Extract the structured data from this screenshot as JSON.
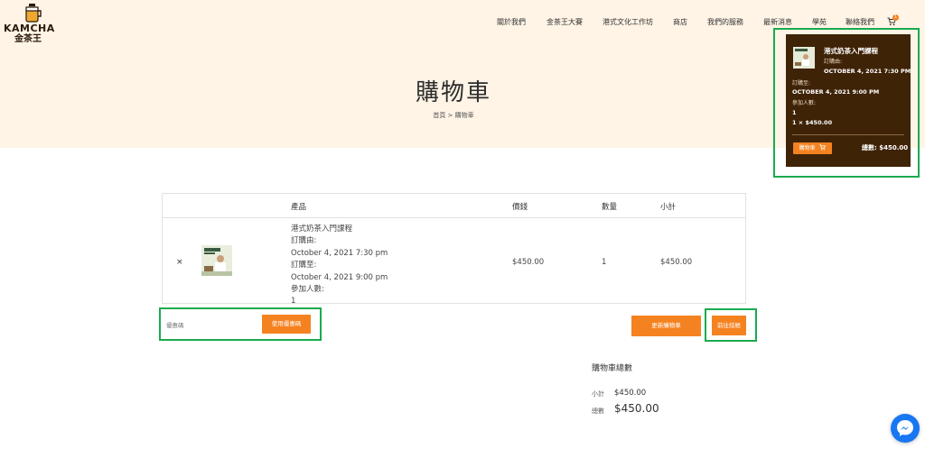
{
  "logo": {
    "title": "KAMCHA",
    "subtitle": "金茶王"
  },
  "nav": {
    "items": [
      {
        "label": "關於我們"
      },
      {
        "label": "金茶王大賽"
      },
      {
        "label": "港式文化工作坊"
      },
      {
        "label": "商店"
      },
      {
        "label": "我們的服務"
      },
      {
        "label": "最新消息"
      },
      {
        "label": "學苑"
      },
      {
        "label": "聯絡我們"
      }
    ],
    "cart_count": "1"
  },
  "page": {
    "title": "購物車",
    "breadcrumb": "首頁 > 購物車"
  },
  "mini_cart": {
    "item_name": "港式奶茶入門課程",
    "from_label": "訂購由:",
    "from_value": "OCTOBER 4, 2021 7:30 PM",
    "to_label": "訂購至:",
    "to_value": "OCTOBER 4, 2021 9:00 PM",
    "people_label": "參加人數:",
    "people_value": "1",
    "qty_price": "1 × $450.00",
    "cart_button": "購物車",
    "total": "總數: $450.00"
  },
  "cart_table": {
    "headers": {
      "product": "產品",
      "price": "價錢",
      "qty": "數量",
      "subtotal": "小計"
    },
    "row": {
      "remove": "×",
      "lines": [
        "港式奶茶入門課程",
        "訂購由:",
        "October 4, 2021 7:30 pm",
        "訂購至:",
        "October 4, 2021 9:00 pm",
        "參加人數:",
        "1"
      ],
      "price": "$450.00",
      "qty": "1",
      "subtotal": "$450.00"
    }
  },
  "coupon": {
    "label": "優惠碼",
    "button": "使用優惠碼"
  },
  "actions": {
    "update": "更新購物車",
    "checkout": "前往結帳"
  },
  "totals": {
    "title": "購物車總數",
    "subtotal_label": "小計",
    "subtotal_value": "$450.00",
    "total_label": "總數",
    "total_value": "$450.00"
  },
  "colors": {
    "accent": "#f58220",
    "hero_bg": "#fff4e6",
    "mini_cart_bg": "#3f2307",
    "highlight": "#1aab4f"
  }
}
